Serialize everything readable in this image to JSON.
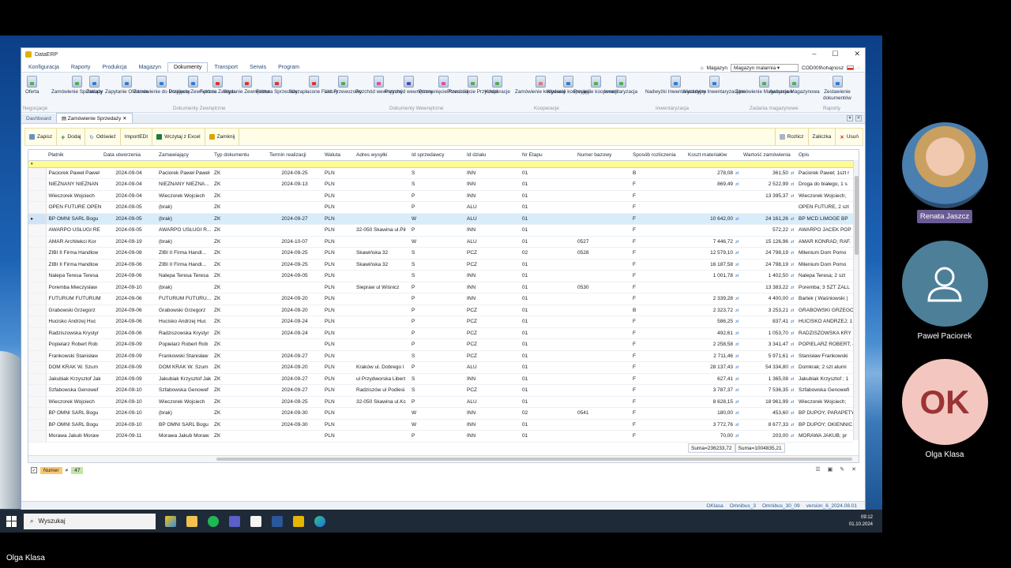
{
  "window": {
    "title": "DataERP",
    "controls": [
      "–",
      "☐",
      "✕"
    ]
  },
  "menu": [
    "Konfiguracja",
    "Raporty",
    "Produkcja",
    "Magazyn",
    "Dokumenty",
    "Transport",
    "Serwis",
    "Program"
  ],
  "active_menu": "Dokumenty",
  "topright": {
    "label": "Magazyn",
    "value": "Magazyn malarnia",
    "user": "COD009\\ohajnosz"
  },
  "ribbon": {
    "buttons": [
      {
        "label": "Oferta",
        "color": "#4caf50"
      },
      {
        "label": "Zamówienie Sprzedaży",
        "color": "#4caf50"
      },
      {
        "label": "Zakupy",
        "color": "#2e7dd1"
      },
      {
        "label": "Zapytanie Ofertowe",
        "color": "#2e7dd1"
      },
      {
        "label": "Zamówienie do Dostawcy",
        "color": "#2e7dd1"
      },
      {
        "label": "Przyjęcie Zewnętrzne",
        "color": "#2e7dd1"
      },
      {
        "label": "Faktura Zakupu",
        "color": "#d9342b"
      },
      {
        "label": "Wydanie Zewnętrzne",
        "color": "#d9342b"
      },
      {
        "label": "Faktura Sprzedaży",
        "color": "#d9342b"
      },
      {
        "label": "Niezapłacone Faktury",
        "color": "#d9342b"
      },
      {
        "label": "List Przewozowy",
        "color": "#4caf50"
      },
      {
        "label": "Rozchód wewnętrzny",
        "color": "#d94fa0"
      },
      {
        "label": "Przychód wewnętrzny",
        "color": "#3f51b5"
      },
      {
        "label": "Przesunięcie Rozchód",
        "color": "#d94fa0"
      },
      {
        "label": "Przesunięcie Przychód",
        "color": "#4caf50"
      },
      {
        "label": "Kooperacje",
        "color": "#4caf50"
      },
      {
        "label": "Zamówienie kooperacji",
        "color": "#e57373"
      },
      {
        "label": "Wydanie kooperacji",
        "color": "#2e7dd1"
      },
      {
        "label": "Przyjęcie kooperacji",
        "color": "#4caf50"
      },
      {
        "label": "Inwentaryzacja",
        "color": "#4caf50"
      },
      {
        "label": "Nadwyżki Inwentaryzacyjne",
        "color": "#2e7dd1"
      },
      {
        "label": "Niedobory Inwentaryzacyjne",
        "color": "#2e7dd1"
      },
      {
        "label": "Zamówienie Magazynowe",
        "color": "#4caf50"
      },
      {
        "label": "Awizacja Magazynowa",
        "color": "#4caf50"
      },
      {
        "label": "Zestawienie dokumentów",
        "color": "#2e7dd1"
      }
    ],
    "groups": [
      "Negocjacje",
      "Dokumenty Zewnętrzne",
      "Dokumenty Wewnętrzne",
      "Kooperacje",
      "Inwentaryzacja",
      "Zadania magazynowe",
      "Raporty"
    ]
  },
  "doctabs": [
    "Dashboard",
    "Zamówienie Sprzedaży"
  ],
  "toolbar": {
    "left": [
      "Zapisz",
      "Dodaj",
      "Odśwież",
      "ImportEDI",
      "Wczytaj z Excel",
      "Zamknij"
    ],
    "right": [
      "Rozlicz",
      "Zaliczka",
      "Usuń"
    ]
  },
  "columns": [
    "Płatnik",
    "Data utworzenia",
    "Zamawiający",
    "Typ dokumentu",
    "Termin realizacji",
    "Waluta",
    "Adres wysyłki",
    "Id sprzedawcy",
    "Id działu",
    "Nr Etapu",
    "Numer bazowy",
    "Sposób rozliczenia",
    "Koszt materiałów",
    "Wartość zamówienia",
    "Opis"
  ],
  "rows": [
    [
      "Paciorek Paweł Paweł",
      "2024-09-04",
      "Paciorek Paweł Paweł",
      "ZK",
      "2024-09-25",
      "PLN",
      "",
      "S",
      "INN",
      "01",
      "",
      "B",
      "278,08",
      "361,50",
      "Paciorek Paweł; 1szt r"
    ],
    [
      "NIEZNANY NIEZNAN",
      "2024-09-04",
      "NIEZNANY NIEZNA...",
      "ZK",
      "2024-09-13",
      "PLN",
      "",
      "S",
      "INN",
      "01",
      "",
      "F",
      "869,49",
      "2 522,99",
      "Droga do białego, 1 s"
    ],
    [
      "Wieczorek Wojciech",
      "2024-09-04",
      "Wieczorek Wojciech",
      "ZK",
      "",
      "PLN",
      "",
      "P",
      "INN",
      "01",
      "",
      "F",
      "",
      "13 395,37",
      "Wieczorek Wojciech;"
    ],
    [
      "OPEN FUTURE OPEN",
      "2024-09-05",
      "(brak)",
      "ZK",
      "",
      "PLN",
      "",
      "P",
      "ALU",
      "01",
      "",
      "F",
      "",
      "",
      "OPEN FUTURE, 2 szt"
    ],
    [
      "BP OMNI SARL Bogu",
      "2024-09-05",
      "(brak)",
      "ZK",
      "2024-09-27",
      "PLN",
      "",
      "W",
      "ALU",
      "01",
      "",
      "F",
      "10 642,00",
      "24 161,26",
      "BP MCD LIMOGE BP"
    ],
    [
      "AWARPO USŁUGI RE",
      "2024-09-05",
      "AWARPO USŁUGI R...",
      "ZK",
      "",
      "PLN",
      "32-050 Skawina ul.Pił",
      "P",
      "INN",
      "01",
      "",
      "F",
      "",
      "572,22",
      "AWARPO JACEK POP"
    ],
    [
      "AMAR Architekci Kor",
      "2024-09-19",
      "(brak)",
      "ZK",
      "2024-10-07",
      "PLN",
      "",
      "W",
      "ALU",
      "01",
      "0527",
      "F",
      "7 446,72",
      "15 126,96",
      "AMAR KONRAD; RAF."
    ],
    [
      "ZIBI II Firma Handlow",
      "2024-09-08",
      "ZIBI II Firma Handl...",
      "ZK",
      "2024-09-25",
      "PLN",
      "Skawińska 32",
      "S",
      "PCZ",
      "02",
      "0528",
      "F",
      "12 579,10",
      "24 798,19",
      "Milenium Dom Pomo"
    ],
    [
      "ZIBI II Firma Handlow",
      "2024-09-06",
      "ZIBI II Firma Handl...",
      "ZK",
      "2024-09-25",
      "PLN",
      "Skawińska 32",
      "S",
      "PCZ",
      "01",
      "",
      "F",
      "16 187,58",
      "24 798,19",
      "Milenium Dom Pomo"
    ],
    [
      "Nalepa Teresa Teresa",
      "2024-09-06",
      "Nalepa Teresa Teresa",
      "ZK",
      "2024-09-05",
      "PLN",
      "",
      "S",
      "INN",
      "01",
      "",
      "F",
      "1 001,78",
      "1 402,50",
      "Nalepa Teresa; 2 szt"
    ],
    [
      "Poremba Mieczysław",
      "2024-09-10",
      "(brak)",
      "ZK",
      "",
      "PLN",
      "Sieprаw ul Wiśnicz",
      "P",
      "INN",
      "01",
      "0530",
      "F",
      "",
      "13 383,22",
      "Poremba; 3 SZT ZALL"
    ],
    [
      "FUTURUM FUTURUM",
      "2024-09-06",
      "FUTURUM FUTURU...",
      "ZK",
      "2024-09-20",
      "PLN",
      "",
      "P",
      "INN",
      "01",
      "",
      "F",
      "2 339,28",
      "4 400,00",
      "Bartek ( Waśniowski )"
    ],
    [
      "Grabowski Grzegorz",
      "2024-09-06",
      "Grabowski Grzegorz",
      "ZK",
      "2024-09-20",
      "PLN",
      "",
      "P",
      "PCZ",
      "01",
      "",
      "B",
      "2 323,72",
      "3 253,21",
      "GRABOWSKI GRZEGO"
    ],
    [
      "Hucisko Andrzej Huc",
      "2024-09-06",
      "Hucisko Andrzej Huc",
      "ZK",
      "2024-09-24",
      "PLN",
      "",
      "P",
      "PCZ",
      "01",
      "",
      "F",
      "586,25",
      "837,41",
      "HUCISKO ANDRZEJ; 1"
    ],
    [
      "Radziszowska Krystyr",
      "2024-09-06",
      "Radziszowska Krystyr",
      "ZK",
      "2024-09-24",
      "PLN",
      "",
      "P",
      "PCZ",
      "01",
      "",
      "F",
      "492,61",
      "1 053,70",
      "RADZISZOWSKA KRY"
    ],
    [
      "Popielarz Robert Rob",
      "2024-09-09",
      "Popielarz Robert Rob",
      "ZK",
      "",
      "PLN",
      "",
      "P",
      "PCZ",
      "01",
      "",
      "F",
      "2 258,58",
      "3 341,47",
      "POPIELARZ ROBERT; -"
    ],
    [
      "Frankowski Stanisław",
      "2024-09-09",
      "Frankowski Stanisław",
      "ZK",
      "2024-09-27",
      "PLN",
      "",
      "S",
      "PCZ",
      "01",
      "",
      "F",
      "2 711,46",
      "5 971,61",
      "Stanisław Frankowski"
    ],
    [
      "DOM KRAK W. Szum",
      "2024-09-09",
      "DOM KRAK W. Szum",
      "ZK",
      "2024-09-20",
      "PLN",
      "Kraków ul. Dobrego I",
      "P",
      "ALU",
      "01",
      "",
      "F",
      "28 137,43",
      "54 334,80",
      "Domkrak; 2 szt alumi"
    ],
    [
      "Jakubiak Krzysztof Jak",
      "2024-09-09",
      "Jakubiak Krzysztof Jak",
      "ZK",
      "2024-09-27",
      "PLN",
      "ul Przydworska Libert",
      "S",
      "INN",
      "01",
      "",
      "F",
      "627,41",
      "1 365,08",
      "Jakubiak Krzysztof ; 1"
    ],
    [
      "Szfabowska Genowef",
      "2024-09-10",
      "Szfabowska Genowef",
      "ZK",
      "2024-09-27",
      "PLN",
      "Radziszów ul Podlesi",
      "S",
      "PCZ",
      "01",
      "",
      "F",
      "3 787,37",
      "7 536,35",
      "Szfabowska Genowefi"
    ],
    [
      "Wieczorek Wojciech",
      "2024-09-10",
      "Wieczorek Wojciech",
      "ZK",
      "2024-09-25",
      "PLN",
      "32-050 Skawina ul.Kc",
      "P",
      "ALU",
      "01",
      "",
      "F",
      "8 628,15",
      "18 961,99",
      "Wieczorek Wojciech;"
    ],
    [
      "BP OMNI SARL Bogu",
      "2024-09-10",
      "(brak)",
      "ZK",
      "2024-09-30",
      "PLN",
      "",
      "W",
      "INN",
      "02",
      "0541",
      "F",
      "180,00",
      "453,60",
      "BP DUPOY; PARAPETY"
    ],
    [
      "BP OMNI SARL Bogu",
      "2024-09-10",
      "BP OMNI SARL Bogu",
      "ZK",
      "2024-09-30",
      "PLN",
      "",
      "W",
      "INN",
      "01",
      "",
      "F",
      "3 772,76",
      "8 677,33",
      "BP DUPOY; OKIENNIC"
    ],
    [
      "Morawa Jakub Moraw",
      "2024-09-11",
      "Morawa Jakub Moraw",
      "ZK",
      "",
      "PLN",
      "",
      "P",
      "INN",
      "01",
      "",
      "F",
      "70,00",
      "203,00",
      "MORAWA JAKUB; pr"
    ]
  ],
  "currency_symbol": "zł",
  "sums": [
    "Suma=236233,72",
    "Suma=1004835,21"
  ],
  "filter": {
    "field": "Numer",
    "op": "≠",
    "value": "47"
  },
  "status": [
    "OKlasa",
    "Omnibus_3",
    "Omnibus_30_09",
    "version_6_2024.08.01"
  ],
  "taskbar": {
    "search": "Wyszukaj",
    "time": "09:12",
    "date": "01.10.2024"
  },
  "participants": [
    {
      "name": "Renata Jaszcz"
    },
    {
      "name": "Paweł Paciorek"
    },
    {
      "name": "Olga Klasa",
      "initials": "OK"
    }
  ],
  "owner_label": "Olga Klasa"
}
